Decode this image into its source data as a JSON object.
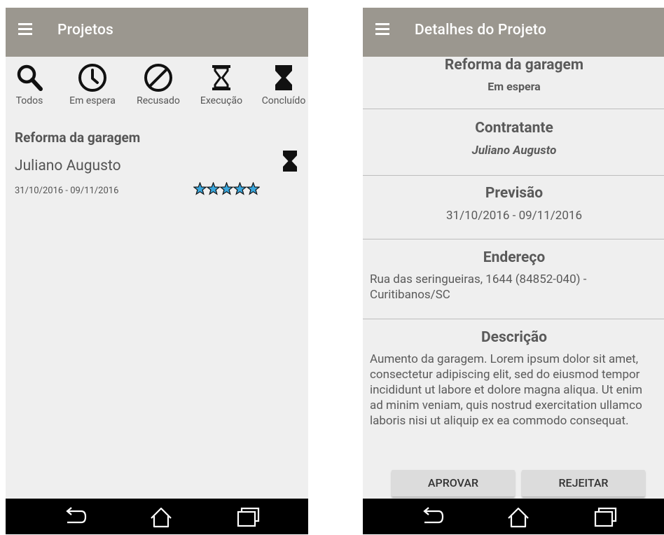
{
  "left_screen": {
    "appbar": {
      "title": "Projetos",
      "menu_icon": "hamburger-menu-icon"
    },
    "filters": [
      {
        "label": "Todos",
        "icon": "search-icon"
      },
      {
        "label": "Em espera",
        "icon": "clock-icon"
      },
      {
        "label": "Recusado",
        "icon": "block-icon"
      },
      {
        "label": "Execução",
        "icon": "hourglass-empty-icon"
      },
      {
        "label": "Concluído",
        "icon": "hourglass-full-icon"
      }
    ],
    "project": {
      "title": "Reforma da garagem",
      "client": "Juliano Augusto",
      "dates": "31/10/2016 - 09/11/2016",
      "status_icon": "hourglass-full-icon",
      "rating": 5,
      "rating_max": 5,
      "star_color": "#3aa6dc"
    }
  },
  "right_screen": {
    "appbar": {
      "title": "Detalhes do Projeto",
      "menu_icon": "hamburger-menu-icon"
    },
    "project_title": "Reforma da garagem",
    "status": "Em espera",
    "contratante": {
      "heading": "Contratante",
      "value": "Juliano Augusto"
    },
    "previsao": {
      "heading": "Previsão",
      "value": "31/10/2016 - 09/11/2016"
    },
    "endereco": {
      "heading": "Endereço",
      "value": "Rua das seringueiras, 1644 (84852-040) - Curitibanos/SC"
    },
    "descricao": {
      "heading": "Descrição",
      "value": "Aumento da garagem. Lorem ipsum dolor sit amet, consectetur adipiscing elit, sed do eiusmod tempor incididunt ut labore et dolore magna aliqua. Ut enim ad minim veniam, quis nostrud exercitation ullamco laboris nisi ut aliquip ex ea commodo consequat."
    },
    "buttons": {
      "approve": "APROVAR",
      "reject": "REJEITAR"
    }
  },
  "navbar": {
    "icons": [
      "back-icon",
      "home-icon",
      "recent-apps-icon"
    ]
  },
  "colors": {
    "appbar": "#9b978f",
    "background": "#efefef",
    "navbar": "#000000",
    "text": "#555555",
    "button": "#dcdcdc"
  }
}
